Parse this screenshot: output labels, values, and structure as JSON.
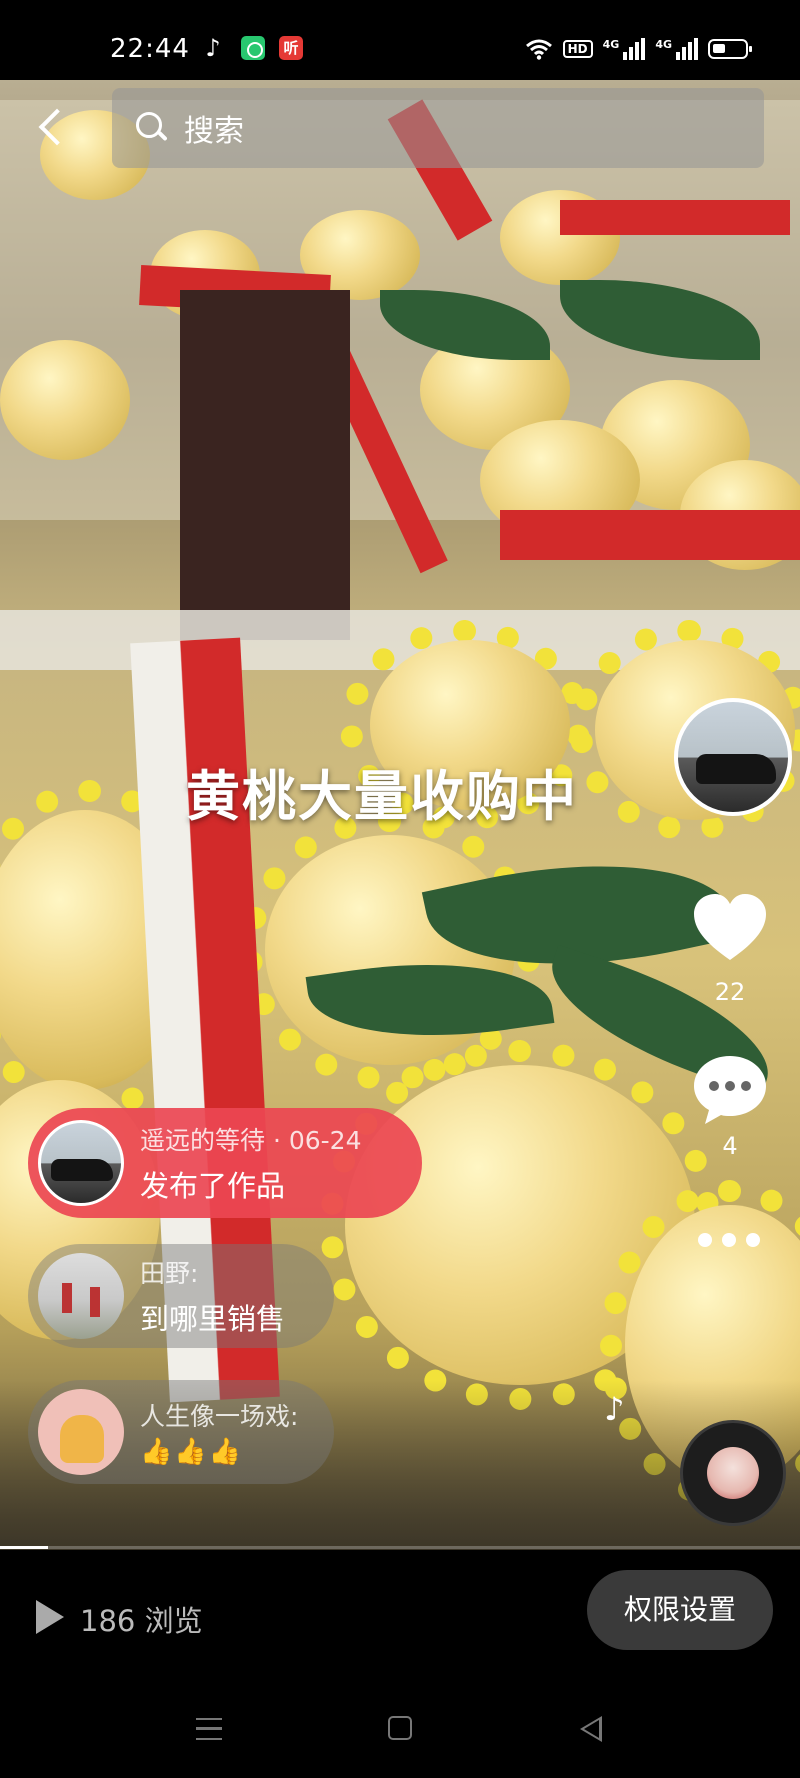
{
  "status_bar": {
    "time": "22:44",
    "app_icons": [
      "tiktok-icon",
      "green-app-icon",
      "listen-app-icon"
    ],
    "listen_label": "听",
    "network_badge": "HD",
    "signal1_label": "4G",
    "signal2_label": "4G"
  },
  "search": {
    "placeholder": "搜索"
  },
  "video": {
    "caption": "黄桃大量收购中"
  },
  "right_rail": {
    "like_count": "22",
    "comment_count": "4"
  },
  "comments": [
    {
      "author": "遥远的等待 · 06-24",
      "message": "发布了作品"
    },
    {
      "author": "田野:",
      "message": "到哪里销售"
    },
    {
      "author": "人生像一场戏:",
      "message": "👍👍👍"
    }
  ],
  "progress": {
    "played_fraction": 0.06
  },
  "bottom_bar": {
    "views": "186 浏览",
    "permission_button": "权限设置"
  },
  "colors": {
    "publish_bubble": "#ec4652",
    "background": "#000000"
  }
}
